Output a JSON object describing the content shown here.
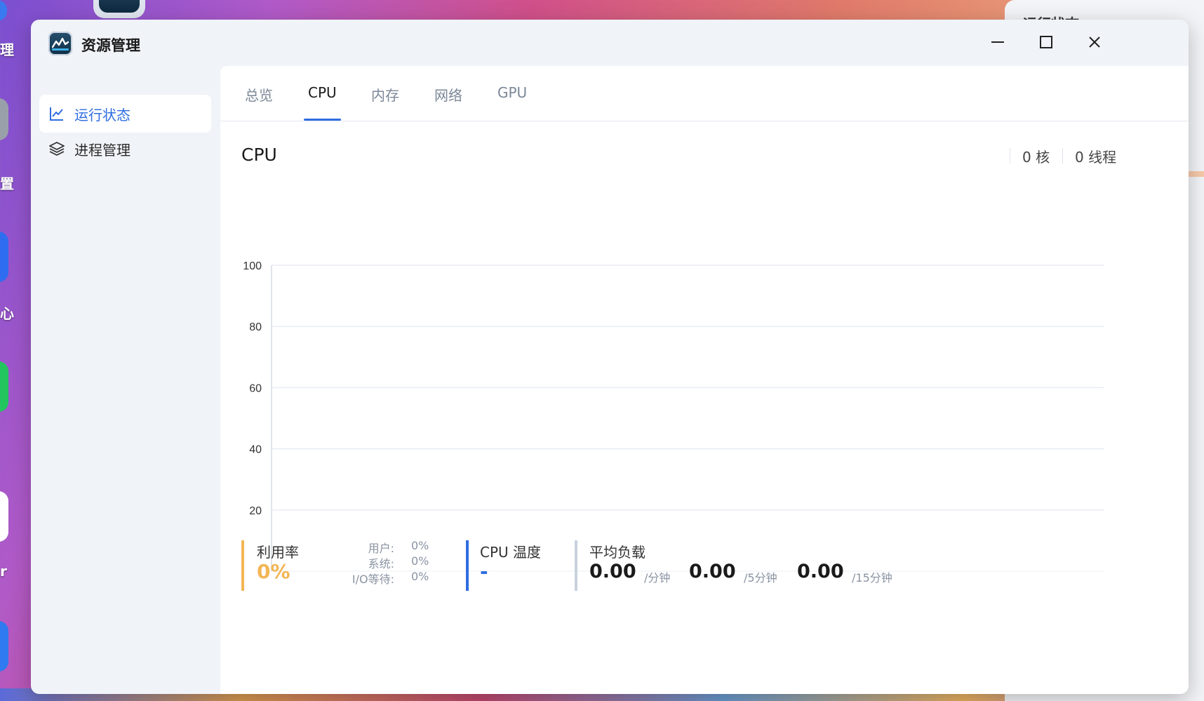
{
  "desktop": {
    "labels": [
      "理",
      "置",
      "心",
      "r"
    ],
    "behind_window_title": "运行状态"
  },
  "window": {
    "title": "资源管理",
    "controls": {
      "minimize": "minimize-icon",
      "maximize": "maximize-icon",
      "close": "close-icon"
    }
  },
  "sidebar": {
    "items": [
      {
        "label": "运行状态",
        "icon": "line-chart-icon",
        "active": true
      },
      {
        "label": "进程管理",
        "icon": "layers-icon",
        "active": false
      }
    ]
  },
  "tabs": [
    {
      "label": "总览",
      "active": false
    },
    {
      "label": "CPU",
      "active": true
    },
    {
      "label": "内存",
      "active": false
    },
    {
      "label": "网络",
      "active": false
    },
    {
      "label": "GPU",
      "active": false
    }
  ],
  "cpu": {
    "title": "CPU",
    "cores": "0 核",
    "threads": "0 线程"
  },
  "chart_data": {
    "type": "line",
    "title": "",
    "xlabel": "",
    "ylabel": "",
    "ylim": [
      0,
      100
    ],
    "yticks": [
      "100",
      "80",
      "60",
      "40",
      "20"
    ],
    "grid": true,
    "series": [
      {
        "values": []
      }
    ]
  },
  "metrics": {
    "utilization": {
      "label": "利用率",
      "value": "0%",
      "breakdown": [
        {
          "label": "用户:",
          "value": "0%"
        },
        {
          "label": "系统:",
          "value": "0%"
        },
        {
          "label": "I/O等待:",
          "value": "0%"
        }
      ]
    },
    "temperature": {
      "label": "CPU 温度",
      "value": "-"
    },
    "load": {
      "label": "平均负载",
      "items": [
        {
          "value": "0.00",
          "unit": "/分钟"
        },
        {
          "value": "0.00",
          "unit": "/5分钟"
        },
        {
          "value": "0.00",
          "unit": "/15分钟"
        }
      ]
    }
  },
  "colors": {
    "accent": "#2f6de0",
    "utilization": "#f3b655",
    "temperature": "#2f6de0",
    "load": "#c9d2de"
  }
}
